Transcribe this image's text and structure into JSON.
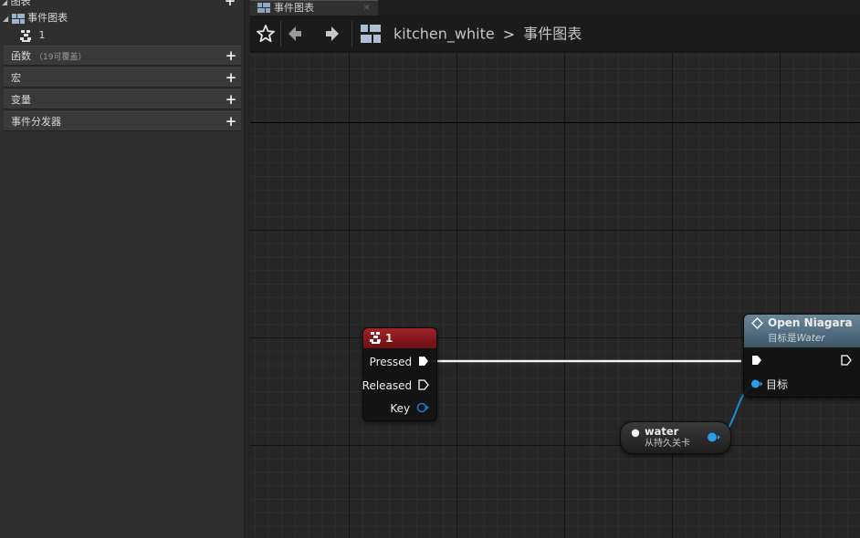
{
  "left_panel": {
    "graphs_header": "图表",
    "event_graph_label": "事件图表",
    "key_event_label": "1",
    "sections": [
      {
        "label": "函数",
        "sub": "（19可覆盖）"
      },
      {
        "label": "宏",
        "sub": ""
      },
      {
        "label": "变量",
        "sub": ""
      },
      {
        "label": "事件分发器",
        "sub": ""
      }
    ],
    "plus_symbol": "+"
  },
  "tab": {
    "label": "事件图表",
    "close": "×"
  },
  "breadcrumb": {
    "root": "kitchen_white",
    "separator": ">",
    "current": "事件图表"
  },
  "graph": {
    "key_node": {
      "title": "1",
      "pins": [
        "Pressed",
        "Released",
        "Key"
      ],
      "header_color": "#a1222a"
    },
    "niagara_node": {
      "title": "Open Niagara",
      "subtitle_prefix": "目标是",
      "subtitle_target": "Water",
      "target_pin": "目标",
      "header_color": "#5a7689"
    },
    "water_node": {
      "title": "water",
      "subtitle": "从持久关卡"
    },
    "colors": {
      "exec_wire": "#ffffff",
      "object_wire": "#1a8fd6",
      "object_pin": "#2a9de6"
    }
  }
}
